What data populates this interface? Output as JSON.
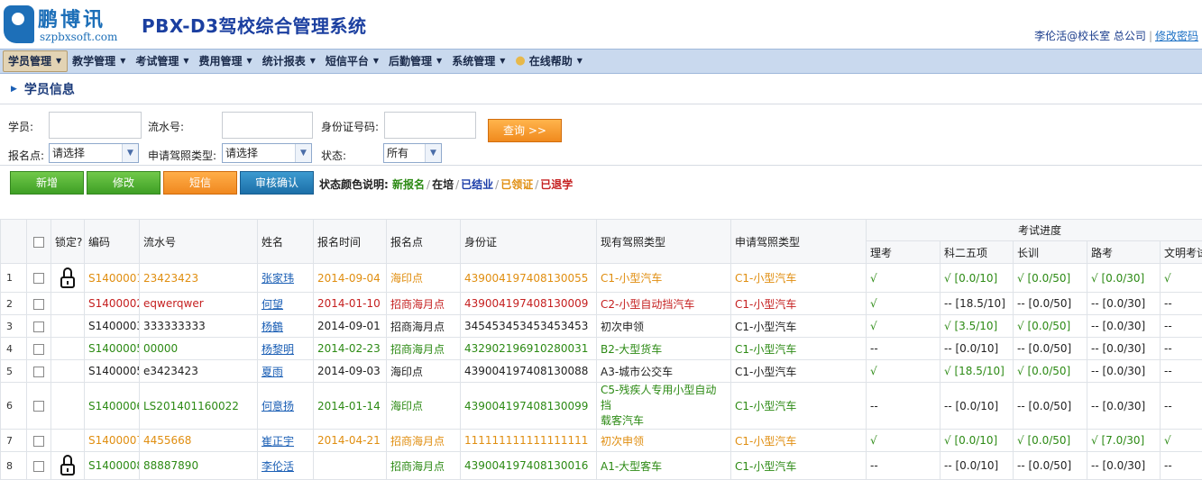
{
  "header": {
    "logo_cn": "鹏博讯",
    "logo_en": "szpbxsoft.com",
    "title": "PBX-D3驾校综合管理系统",
    "user": "李伦活@校长室 总公司",
    "separator": "|",
    "change_password": "修改密码"
  },
  "menu": [
    {
      "label": "学员管理",
      "active": true
    },
    {
      "label": "教学管理"
    },
    {
      "label": "考试管理"
    },
    {
      "label": "费用管理"
    },
    {
      "label": "统计报表"
    },
    {
      "label": "短信平台"
    },
    {
      "label": "后勤管理"
    },
    {
      "label": "系统管理"
    },
    {
      "label": "在线帮助",
      "icon": "lightbulb-icon"
    }
  ],
  "page": {
    "title": "学员信息"
  },
  "filters": {
    "student_label": "学员:",
    "serial_label": "流水号:",
    "idcard_label": "身份证号码:",
    "site_label": "报名点:",
    "site_value": "请选择",
    "license_label": "申请驾照类型:",
    "license_value": "请选择",
    "status_label": "状态:",
    "status_value": "所有",
    "query_button": "查询 >>"
  },
  "toolbar": {
    "add": "新增",
    "edit": "修改",
    "sms": "短信",
    "audit": "审核确认",
    "legend_title": "状态颜色说明:",
    "legend": [
      {
        "label": "新报名",
        "color": "#2c8a14"
      },
      {
        "label": "在培",
        "color": "#222222"
      },
      {
        "label": "已结业",
        "color": "#1a3ca8"
      },
      {
        "label": "已领证",
        "color": "#e08e10"
      },
      {
        "label": "已退学",
        "color": "#c52020"
      }
    ],
    "legend_sep": "/"
  },
  "table": {
    "headers": {
      "locked": "锁定?",
      "code": "编码",
      "serial": "流水号",
      "name": "姓名",
      "date": "报名时间",
      "site": "报名点",
      "idcard": "身份证",
      "current_license": "现有驾照类型",
      "apply_license": "申请驾照类型",
      "progress": "考试进度",
      "theory": "理考",
      "subject25": "科二五项",
      "long": "长训",
      "road": "路考",
      "civil": "文明考试"
    },
    "rows": [
      {
        "no": "1",
        "locked": true,
        "color": "orange",
        "code": "S1400001",
        "serial": "23423423",
        "name": "张家玮",
        "date": "2014-09-04",
        "site": "海印点",
        "idcard": "439004197408130055",
        "current": "C1-小型汽车",
        "apply": "C1-小型汽车",
        "theory": "√",
        "s25": "√ [0.0/10]",
        "long": "√ [0.0/50]",
        "road": "√ [0.0/30]",
        "civil": "√"
      },
      {
        "no": "2",
        "locked": false,
        "color": "red",
        "code": "S1400002",
        "serial": "eqwerqwer",
        "name": "何望",
        "date": "2014-01-10",
        "site": "招商海月点",
        "idcard": "439004197408130009",
        "current": "C2-小型自动挡汽车",
        "apply": "C1-小型汽车",
        "theory": "√",
        "s25": "-- [18.5/10]",
        "long": "-- [0.0/50]",
        "road": "-- [0.0/30]",
        "civil": "--"
      },
      {
        "no": "3",
        "locked": false,
        "color": "black",
        "code": "S1400003",
        "serial": "333333333",
        "name": "杨鶴",
        "date": "2014-09-01",
        "site": "招商海月点",
        "idcard": "345453453453453453",
        "current": "初次申领",
        "apply": "C1-小型汽车",
        "theory": "√",
        "s25": "√ [3.5/10]",
        "long": "√ [0.0/50]",
        "road": "-- [0.0/30]",
        "civil": "--"
      },
      {
        "no": "4",
        "locked": false,
        "color": "green",
        "code": "S1400005",
        "serial": "00000",
        "name": "杨黎明",
        "date": "2014-02-23",
        "site": "招商海月点",
        "idcard": "432902196910280031",
        "current": "B2-大型货车",
        "apply": "C1-小型汽车",
        "theory": "--",
        "s25": "-- [0.0/10]",
        "long": "-- [0.0/50]",
        "road": "-- [0.0/30]",
        "civil": "--"
      },
      {
        "no": "5",
        "locked": false,
        "color": "black",
        "code": "S1400005",
        "serial": "e3423423",
        "name": "夏雨",
        "date": "2014-09-03",
        "site": "海印点",
        "idcard": "439004197408130088",
        "current": "A3-城市公交车",
        "apply": "C1-小型汽车",
        "theory": "√",
        "s25": "√ [18.5/10]",
        "long": "√ [0.0/50]",
        "road": "-- [0.0/30]",
        "civil": "--"
      },
      {
        "no": "6",
        "locked": false,
        "color": "green",
        "code": "S1400006",
        "serial": "LS201401160022",
        "name": "何意扬",
        "date": "2014-01-14",
        "site": "海印点",
        "idcard": "439004197408130099",
        "current": "C5-残疾人专用小型自动挡载客汽车",
        "current_l1": "C5-残疾人专用小型自动挡",
        "current_l2": "载客汽车",
        "apply": "C1-小型汽车",
        "theory": "--",
        "s25": "-- [0.0/10]",
        "long": "-- [0.0/50]",
        "road": "-- [0.0/30]",
        "civil": "--"
      },
      {
        "no": "7",
        "locked": false,
        "color": "orange",
        "code": "S1400007",
        "serial": "4455668",
        "name": "崔正宇",
        "date": "2014-04-21",
        "site": "招商海月点",
        "idcard": "111111111111111111",
        "current": "初次申领",
        "apply": "C1-小型汽车",
        "theory": "√",
        "s25": "√ [0.0/10]",
        "long": "√ [0.0/50]",
        "road": "√ [7.0/30]",
        "civil": "√"
      },
      {
        "no": "8",
        "locked": true,
        "color": "green",
        "code": "S1400008",
        "serial": "88887890",
        "name": "李伦活",
        "date": "",
        "site": "招商海月点",
        "idcard": "439004197408130016",
        "current": "A1-大型客车",
        "apply": "C1-小型汽车",
        "theory": "--",
        "s25": "-- [0.0/10]",
        "long": "-- [0.0/50]",
        "road": "-- [0.0/30]",
        "civil": "--"
      }
    ]
  }
}
